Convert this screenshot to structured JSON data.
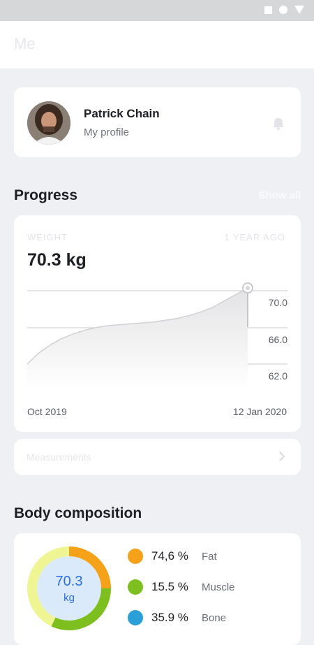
{
  "app_title": "Me",
  "profile": {
    "name": "Patrick Chain",
    "subtitle": "My profile"
  },
  "progress": {
    "title": "Progress",
    "show_all": "Show all",
    "metric_label": "WEIGHT",
    "range_label": "1 YEAR AGO",
    "current_value": "70.3 kg",
    "x_start": "Oct 2019",
    "x_end": "12 Jan 2020"
  },
  "chart_data": {
    "type": "area",
    "x": [
      "Oct 2019",
      "12 Jan 2020"
    ],
    "yticks": [
      "70.0",
      "66.0",
      "62.0"
    ],
    "ylim": [
      62.0,
      70.0
    ],
    "series": [
      {
        "values": [
          62.0,
          63.2,
          64.1,
          64.8,
          65.3,
          65.7,
          66.0,
          66.2,
          66.3,
          66.4,
          66.5,
          66.6,
          66.8,
          67.0,
          67.3,
          67.7,
          68.2,
          68.9,
          69.6,
          70.3
        ]
      }
    ],
    "grid": true
  },
  "measurements": {
    "label": "Measurements"
  },
  "body_composition": {
    "title": "Body composition",
    "center_value": "70.3",
    "center_unit": "kg",
    "items": [
      {
        "value": "74,6 %",
        "name": "Fat",
        "color": "#f5a11a"
      },
      {
        "value": "15.5 %",
        "name": "Muscle",
        "color": "#7cbf1e"
      },
      {
        "value": "35.9 %",
        "name": "Bone",
        "color": "#2a9fd8"
      }
    ],
    "ring_colors": {
      "fat": "#f5a11a",
      "muscle": "#7cbf1e",
      "base": "#eff593",
      "center": "#dbeafb"
    }
  }
}
